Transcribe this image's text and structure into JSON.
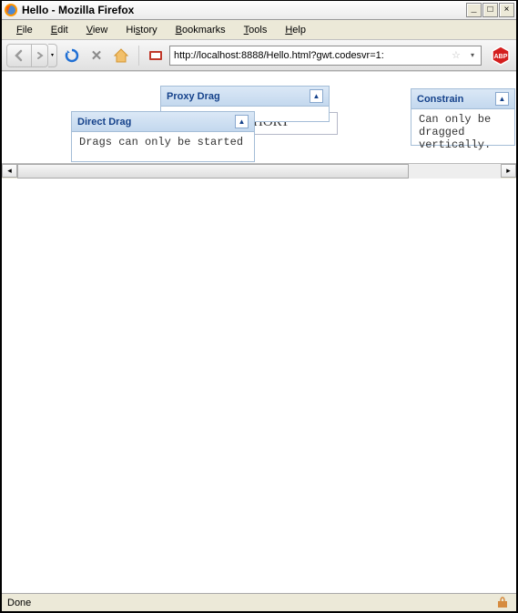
{
  "window": {
    "title": "Hello - Mozilla Firefox"
  },
  "menubar": {
    "file": "File",
    "edit": "Edit",
    "view": "View",
    "history": "History",
    "bookmarks": "Bookmarks",
    "tools": "Tools",
    "help": "Help"
  },
  "toolbar": {
    "url": "http://localhost:8888/Hello.html?gwt.codesvr=1:"
  },
  "panels": {
    "proxy": {
      "title": "Proxy Drag",
      "body": ""
    },
    "direct": {
      "title": "Direct Drag",
      "body": "Drags can only be started"
    },
    "constrain": {
      "title": "Constrain",
      "body": "Can only be dragged vertically."
    },
    "back": {
      "body": "HORT"
    }
  },
  "statusbar": {
    "text": "Done"
  }
}
